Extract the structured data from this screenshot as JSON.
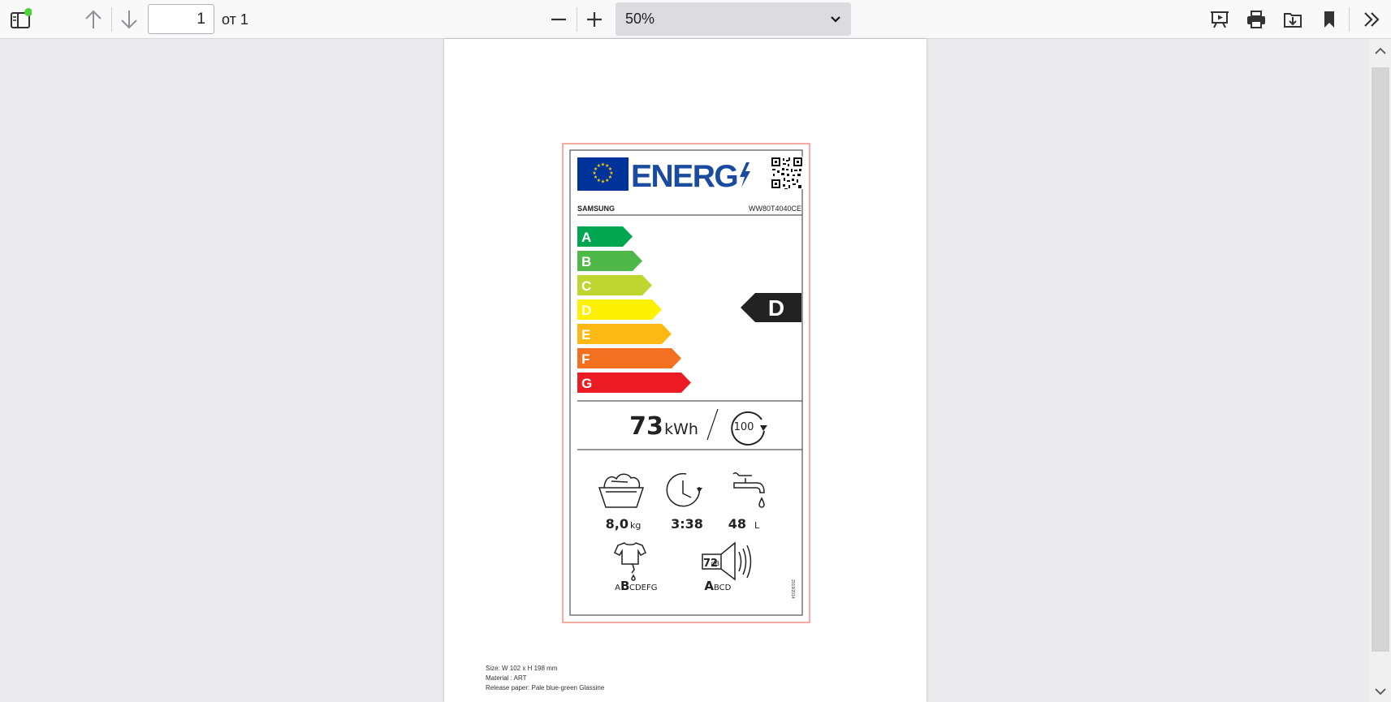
{
  "toolbar": {
    "page_number": "1",
    "page_of": "от 1",
    "zoom_value": "50%",
    "status_dot_color": "#4cd137"
  },
  "label": {
    "energy_word": "ENERG",
    "brand": "SAMSUNG",
    "model": "WW80T4040CE",
    "classes": [
      {
        "letter": "A",
        "color": "#00a650"
      },
      {
        "letter": "B",
        "color": "#50b848"
      },
      {
        "letter": "C",
        "color": "#bfd630"
      },
      {
        "letter": "D",
        "color": "#fff200"
      },
      {
        "letter": "E",
        "color": "#fdb913"
      },
      {
        "letter": "F",
        "color": "#f37021"
      },
      {
        "letter": "G",
        "color": "#ed1c24"
      }
    ],
    "rating": "D",
    "energy_value": "73",
    "energy_unit": "kWh",
    "cycles": "100",
    "capacity_value": "8,0",
    "capacity_unit": "kg",
    "duration": "3:38",
    "water_value": "48",
    "water_unit": "L",
    "spin_class_big": "B",
    "spin_class_a": "A",
    "spin_class_rest": "CDEFG",
    "noise_value": "72",
    "noise_unit": "dB",
    "noise_class_big": "A",
    "noise_class_rest": "BCD",
    "regulation": "2019/2014"
  },
  "page_notes": [
    "Size: W 102 x H 198 mm",
    "Material : ART",
    "Release paper: Pale blue-green Glassine"
  ]
}
